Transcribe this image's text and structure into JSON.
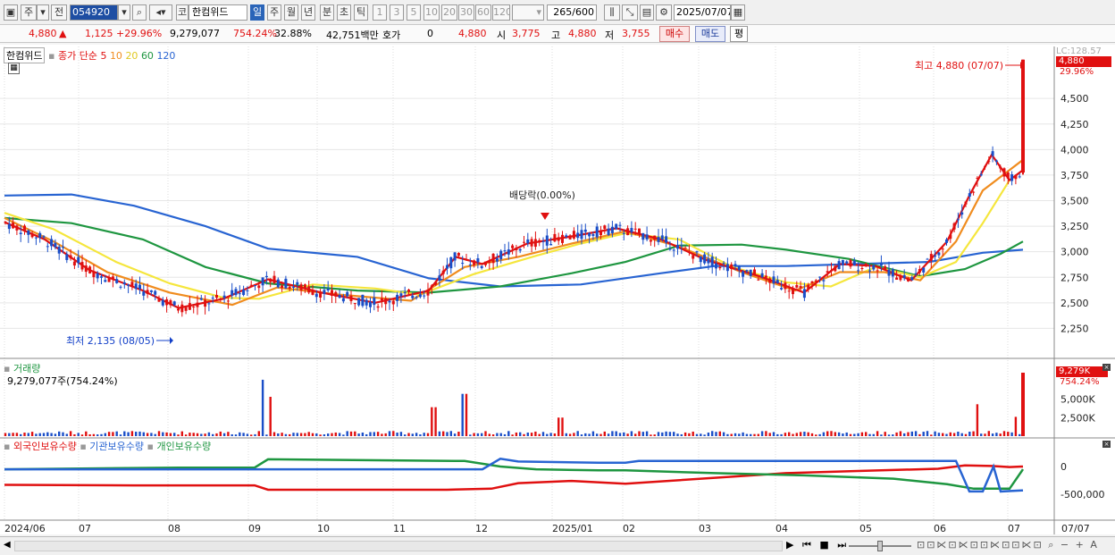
{
  "toolbar": {
    "market_btn": "주",
    "prev_btn": "전",
    "code": "054920",
    "code_btn": "코",
    "name": "한컴위드",
    "periods": [
      "일",
      "주",
      "월",
      "년",
      "분",
      "초",
      "틱"
    ],
    "active_period": "일",
    "intervals": [
      "1",
      "3",
      "5",
      "10",
      "20",
      "30",
      "60",
      "120"
    ],
    "count": "265",
    "count_total": "/600",
    "date": "2025/07/07"
  },
  "info": {
    "price": "4,880",
    "arrow": "▲",
    "change": "1,125",
    "change_pct": "+29.96%",
    "volume": "9,279,077",
    "vol_ratio": "754.24%",
    "turnover": "32.88%",
    "amount": "42,751백만",
    "hoga_label": "호가",
    "hoga_val": "0",
    "hoga_price": "4,880",
    "open_label": "시",
    "open": "3,775",
    "high_label": "고",
    "high": "4,880",
    "low_label": "저",
    "low": "3,755",
    "buy": "매수",
    "sell": "매도",
    "avg": "평"
  },
  "price_panel": {
    "title": "한컴위드",
    "ma_label": "종가 단순",
    "ma_periods": [
      "5",
      "10",
      "20",
      "60",
      "120"
    ],
    "ma_colors": [
      "#e01010",
      "#f08c1e",
      "#f5e63c",
      "#1e9640",
      "#2864d2"
    ],
    "yaxis": [
      "4,500",
      "4,250",
      "4,000",
      "3,750",
      "3,500",
      "3,250",
      "3,000",
      "2,750",
      "2,500",
      "2,250"
    ],
    "last_price": "4,880",
    "last_pct": "29.96%",
    "lc_label": "LC:128.57",
    "high_note": "최고 4,880 (07/07)",
    "low_note": "최저 2,135 (08/05)",
    "dividend_note": "배당락(0.00%)"
  },
  "volume_panel": {
    "title": "거래량",
    "value": "9,279,077주(754.24%)",
    "yaxis": [
      "5,000K",
      "2,500K"
    ],
    "last": "9,279K",
    "last_pct": "754.24%"
  },
  "holding_panel": {
    "foreign": "외국인보유수량",
    "inst": "기관보유수량",
    "indiv": "개인보유수량",
    "yaxis": [
      "0",
      "-500,000"
    ],
    "colors": [
      "#e01010",
      "#2864d2",
      "#1e9640"
    ]
  },
  "xaxis": [
    "2024/06",
    "07",
    "08",
    "09",
    "10",
    "11",
    "12",
    "2025/01",
    "02",
    "03",
    "04",
    "05",
    "06",
    "07"
  ],
  "xaxis_right": "07/07"
}
